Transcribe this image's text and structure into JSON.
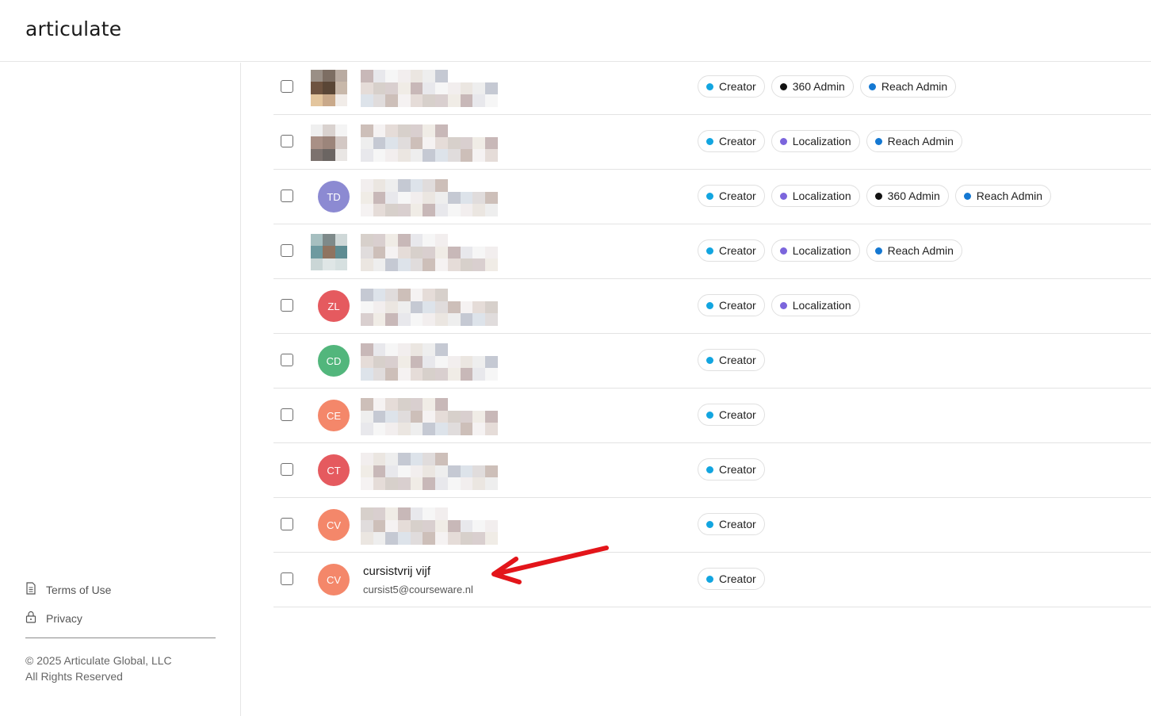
{
  "app": {
    "logo_text": "articulate"
  },
  "sidebar": {
    "links": [
      {
        "label": "Terms of Use",
        "icon": "document-icon"
      },
      {
        "label": "Privacy",
        "icon": "lock-icon"
      }
    ],
    "copyright_line1": "© 2025 Articulate Global, LLC",
    "copyright_line2": "All Rights Reserved"
  },
  "colors": {
    "creator": "#12a5e0",
    "admin360": "#111111",
    "reach_admin": "#1478d2",
    "localization": "#7b65dc",
    "annotation_arrow": "#e3151a"
  },
  "users": [
    {
      "initials": "",
      "name": "",
      "email": "",
      "roles": [
        "Creator",
        "360 Admin",
        "Reach Admin"
      ]
    },
    {
      "initials": "",
      "name": "",
      "email": "",
      "roles": [
        "Creator",
        "Localization",
        "Reach Admin"
      ]
    },
    {
      "initials": "TD",
      "avatar_color": "#8c8ad2",
      "name": "",
      "email": "",
      "roles": [
        "Creator",
        "Localization",
        "360 Admin",
        "Reach Admin"
      ]
    },
    {
      "initials": "",
      "name": "",
      "email": "",
      "roles": [
        "Creator",
        "Localization",
        "Reach Admin"
      ]
    },
    {
      "initials": "ZL",
      "avatar_color": "#e55a5f",
      "name": "",
      "email": "",
      "roles": [
        "Creator",
        "Localization"
      ]
    },
    {
      "initials": "CD",
      "avatar_color": "#52b67c",
      "name": "",
      "email": "",
      "roles": [
        "Creator"
      ]
    },
    {
      "initials": "CE",
      "avatar_color": "#f4876a",
      "name": "",
      "email": "",
      "roles": [
        "Creator"
      ]
    },
    {
      "initials": "CT",
      "avatar_color": "#e55a5f",
      "name": "",
      "email": "",
      "roles": [
        "Creator"
      ]
    },
    {
      "initials": "CV",
      "avatar_color": "#f4876a",
      "name": "",
      "email": "",
      "roles": [
        "Creator"
      ]
    },
    {
      "initials": "CV",
      "avatar_color": "#f4876a",
      "name": "cursistvrij vijf",
      "email": "cursist5@courseware.nl",
      "roles": [
        "Creator"
      ]
    }
  ]
}
